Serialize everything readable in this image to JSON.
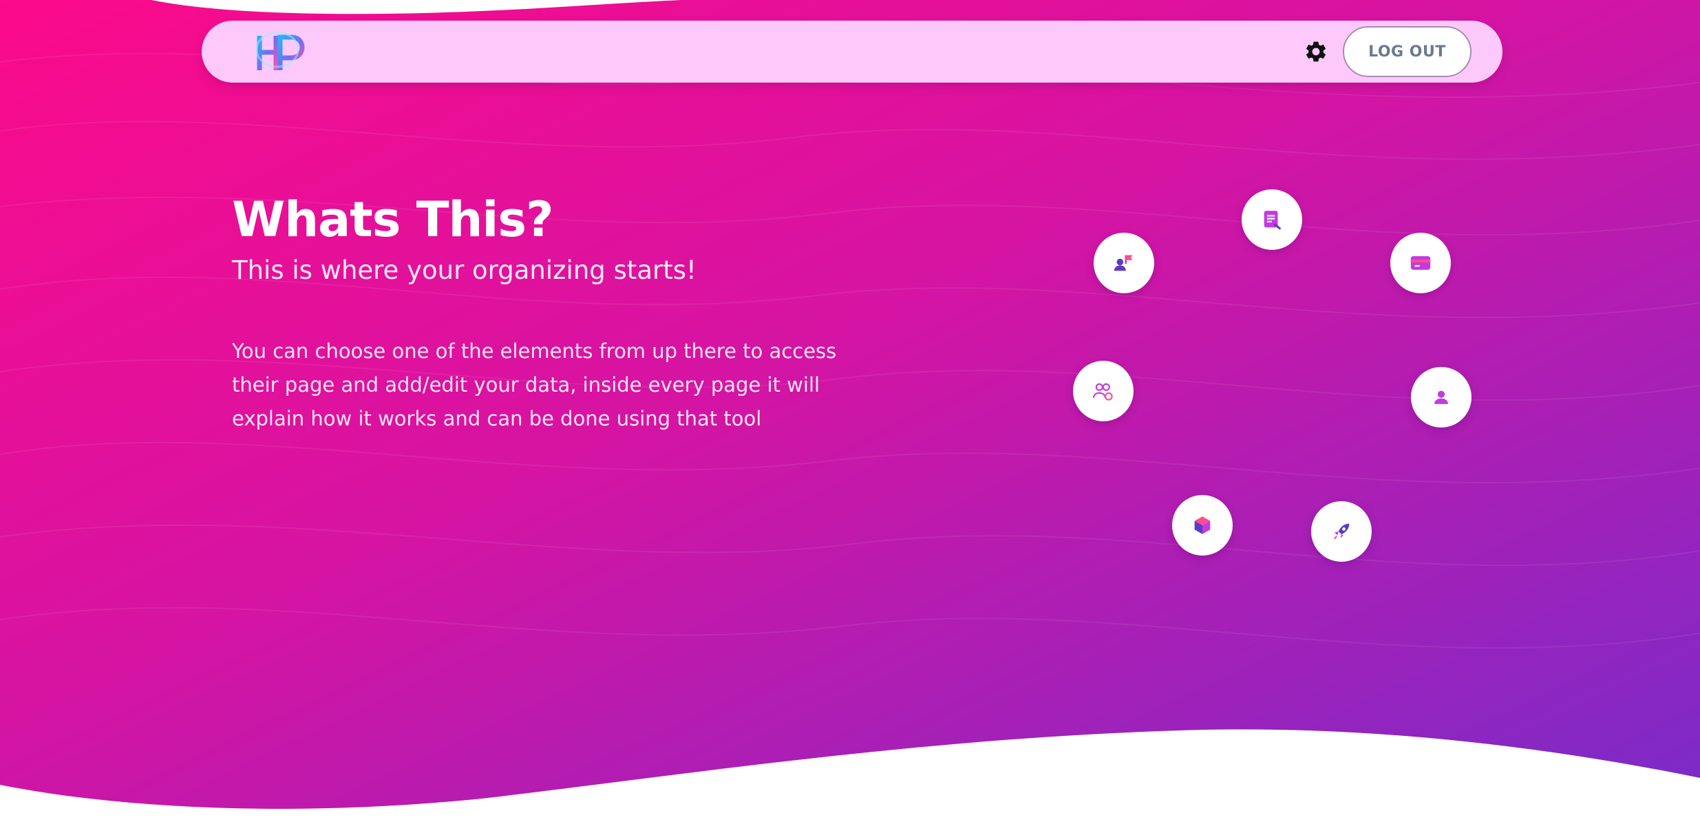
{
  "navbar": {
    "logo_text": "HP",
    "logout_label": "LOG OUT"
  },
  "hero": {
    "title": "Whats This?",
    "subtitle": "This is where your organizing starts!",
    "description": "You can choose one of the elements from up there to access their page and add/edit your data, inside every page it will explain how it works and can be done using that tool"
  },
  "icons": {
    "settings": "gear-icon",
    "orbit": [
      "notes-icon",
      "user-flag-icon",
      "card-icon",
      "team-icon",
      "profile-icon",
      "box-icon",
      "rocket-icon"
    ]
  },
  "colors": {
    "gradient_start": "#fb0a8a",
    "gradient_mid": "#d514a3",
    "gradient_end": "#7a2bc9",
    "navbar_bg": "#fdc9fb",
    "icon_primary": "#c23be0",
    "icon_secondary": "#fb4d8d",
    "icon_dark": "#5b3cc4"
  }
}
